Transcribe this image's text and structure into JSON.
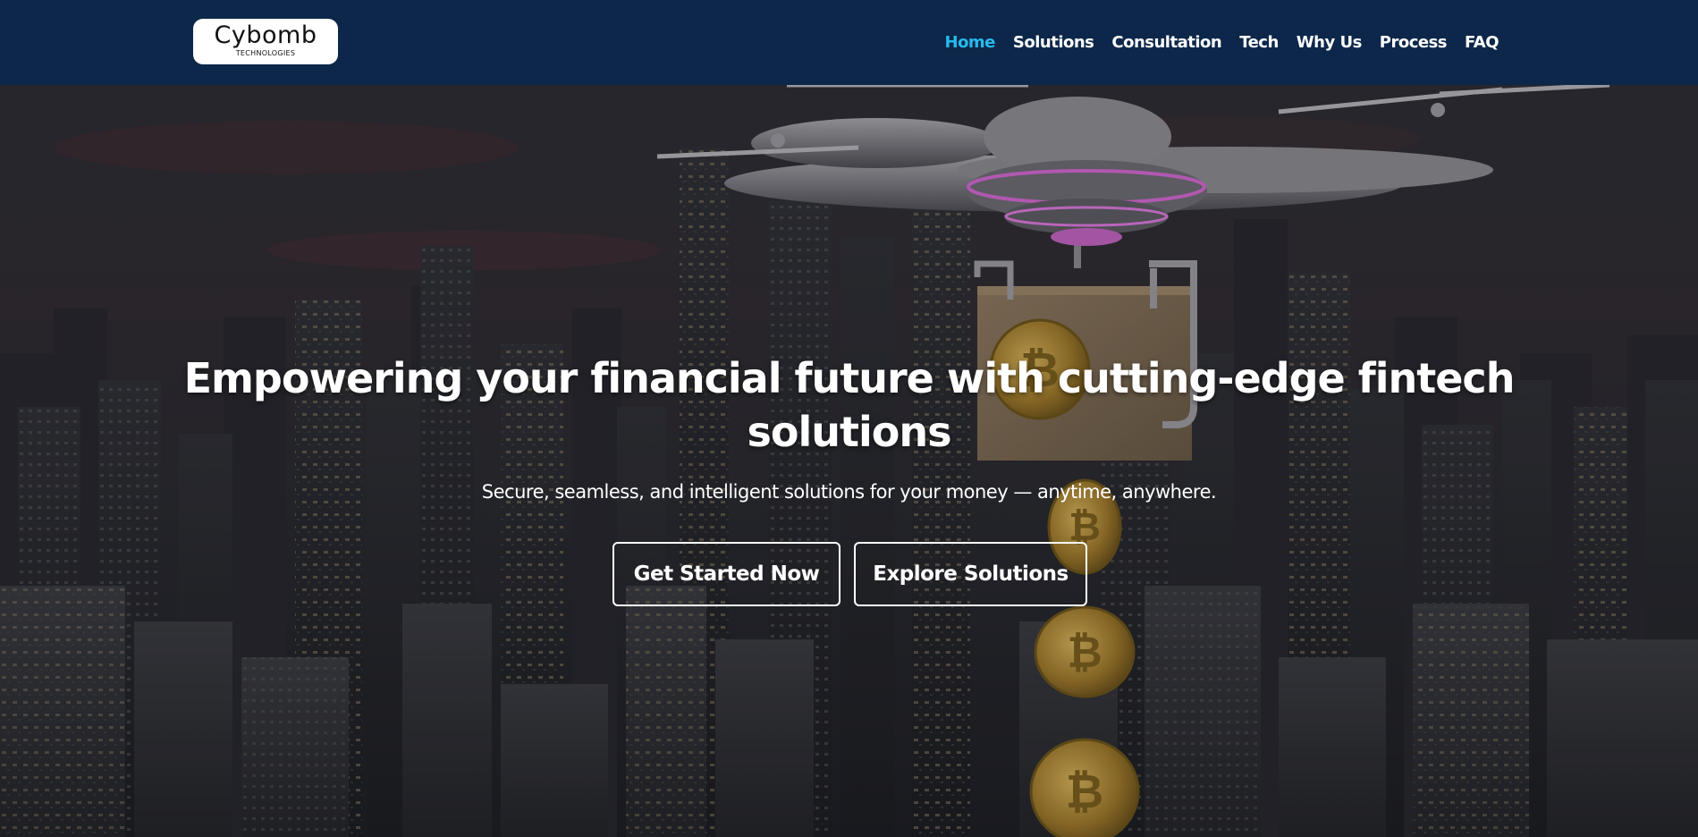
{
  "brand": {
    "name": "Cybomb",
    "tagline": "TECHNOLOGIES"
  },
  "nav": {
    "items": [
      {
        "label": "Home",
        "active": true
      },
      {
        "label": "Solutions",
        "active": false
      },
      {
        "label": "Consultation",
        "active": false
      },
      {
        "label": "Tech",
        "active": false
      },
      {
        "label": "Why Us",
        "active": false
      },
      {
        "label": "Process",
        "active": false
      },
      {
        "label": "FAQ",
        "active": false
      }
    ]
  },
  "hero": {
    "title": "Empowering your financial future with cutting-edge fintech solutions",
    "subtitle": "Secure, seamless, and intelligent solutions for your money — anytime, anywhere.",
    "primary_cta": "Get Started Now",
    "secondary_cta": "Explore Solutions",
    "background_icons": [
      "drone-icon",
      "parcel-box-icon",
      "bitcoin-coin-icon",
      "city-skyline"
    ]
  },
  "colors": {
    "navbar_bg": "#0c2749",
    "nav_active": "#27b9ec",
    "nav_text": "#ffffff",
    "hero_text": "#ffffff",
    "button_border": "#ffffff"
  }
}
